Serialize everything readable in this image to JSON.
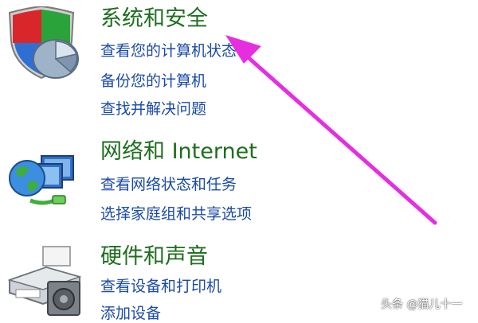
{
  "categories": [
    {
      "title": "系统和安全",
      "icon": "shield-icon",
      "links": [
        "查看您的计算机状态",
        "备份您的计算机",
        "查找并解决问题"
      ]
    },
    {
      "title": "网络和 Internet",
      "icon": "network-globe-icon",
      "links": [
        "查看网络状态和任务",
        "选择家庭组和共享选项"
      ]
    },
    {
      "title": "硬件和声音",
      "icon": "printer-speaker-icon",
      "links": [
        "查看设备和打印机",
        "添加设备"
      ]
    }
  ],
  "annotation": {
    "type": "arrow",
    "color": "#e62ee0"
  },
  "watermark": "头条 @猫儿十一",
  "colors": {
    "title": "#1e6e1e",
    "link": "#1a4aa8"
  }
}
